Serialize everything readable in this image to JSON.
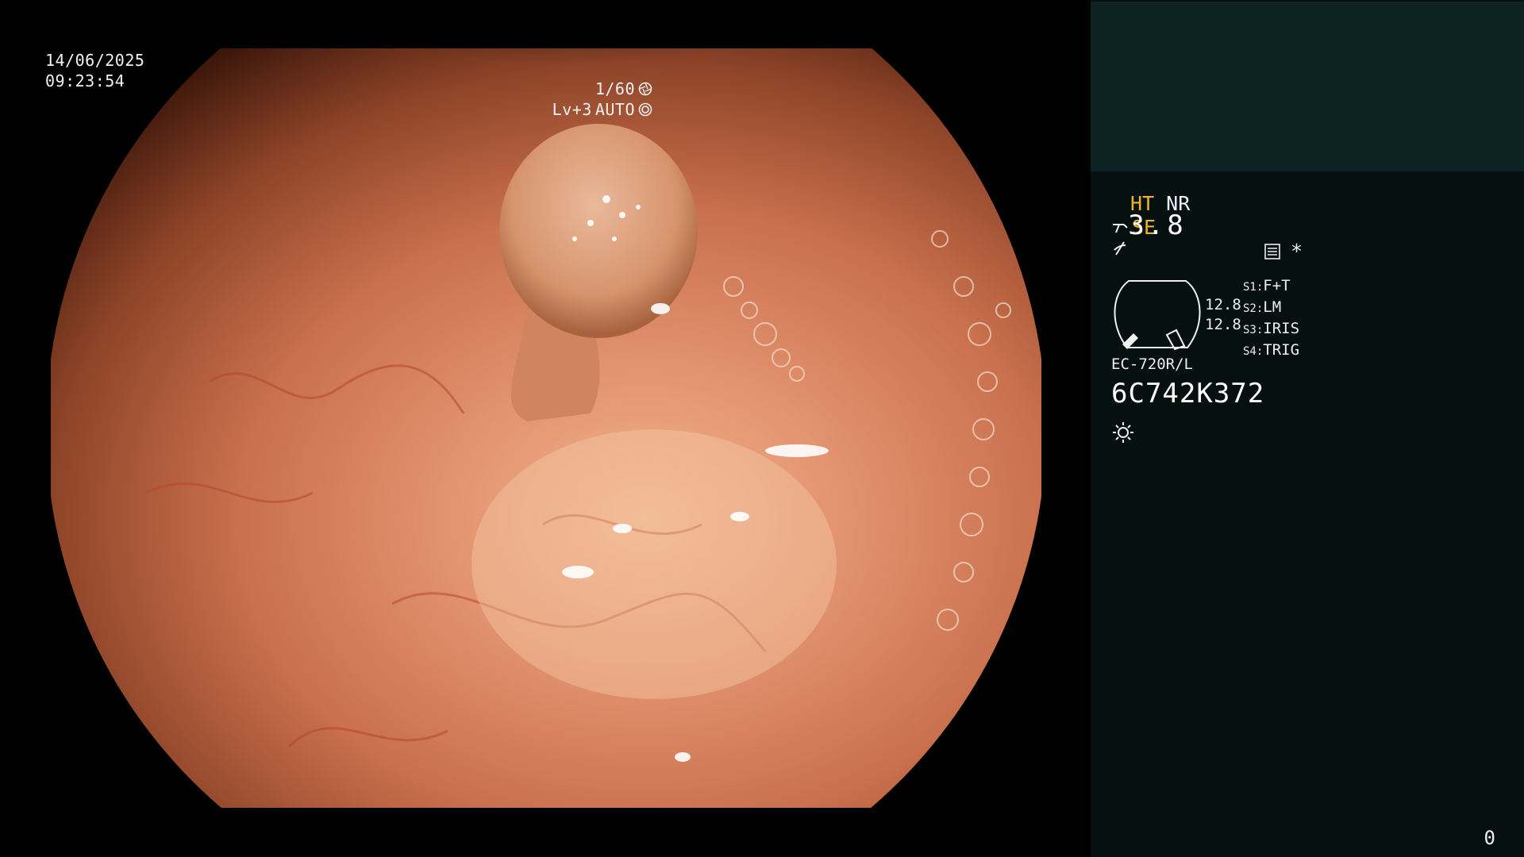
{
  "osd": {
    "date": "14/06/2025",
    "time": "09:23:54",
    "shutter": "1/60",
    "shutter_icon": "aperture-icon",
    "level": "Lv+3",
    "exposure_mode": "AUTO",
    "exposure_icon": "iris-icon"
  },
  "panel": {
    "mode_ht": "HT",
    "mode_nr": "NR",
    "mode_se": "SE",
    "gauge_value": "3.8",
    "readout_1": "12.8",
    "readout_2": "12.8",
    "switches": [
      {
        "key": "S1:",
        "value": "F+T"
      },
      {
        "key": "S2:",
        "value": "LM"
      },
      {
        "key": "S3:",
        "value": "IRIS"
      },
      {
        "key": "S4:",
        "value": "TRIG"
      }
    ],
    "scope_model": "EC-720R/L",
    "scope_serial": "6C742K372",
    "settings_star": "*",
    "counter": "0"
  },
  "colors": {
    "highlight": "#f0b42a",
    "panel_bg": "#06110f",
    "panel_top_bg": "#0d2222",
    "text": "#eeeeee"
  },
  "icons": [
    "aperture-icon",
    "iris-icon",
    "scope-icon",
    "enhance-icon",
    "menu-icon",
    "light-icon"
  ]
}
